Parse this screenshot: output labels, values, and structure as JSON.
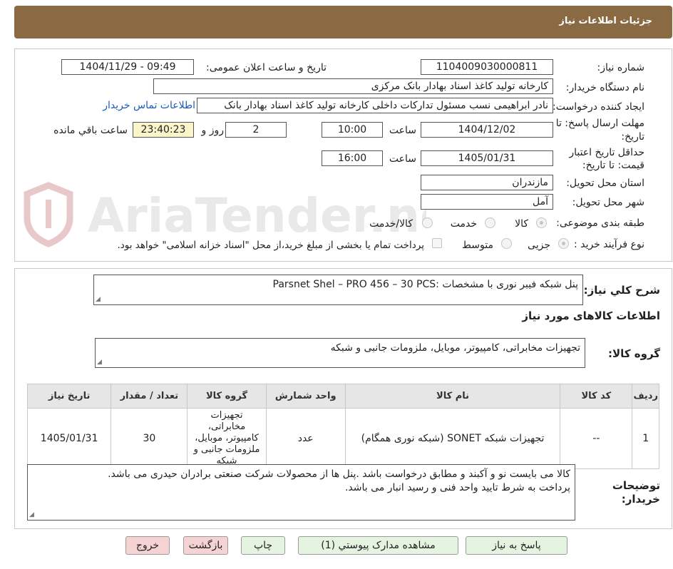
{
  "header": {
    "title": "جزئیات اطلاعات نیاز"
  },
  "form": {
    "need_number_label": "شماره نیاز:",
    "need_number": "1104009030000811",
    "announce_label": "تاریخ و ساعت اعلان عمومی:",
    "announce_value": "1404/11/29 - 09:49",
    "buyer_org_label": "نام دستگاه خریدار:",
    "buyer_org": "کارخانه تولید کاغذ اسناد بهادار بانک مرکزی",
    "creator_label": "ایجاد کننده درخواست:",
    "creator": "نادر ابراهیمی نسب مسئول تدارکات داخلی کارخانه تولید کاغذ اسناد بهادار بانک",
    "contact_link": "اطلاعات تماس خریدار",
    "deadline_label_1": "مهلت ارسال پاسخ: تا",
    "deadline_label_2": "تاریخ:",
    "deadline_date": "1404/12/02",
    "time_label": "ساعت",
    "deadline_time": "10:00",
    "days": "2",
    "days_label": "روز و",
    "remaining_time": "23:40:23",
    "remaining_label": "ساعت باقي مانده",
    "validity_label_1": "حداقل تاریخ اعتبار",
    "validity_label_2": "قیمت: تا تاریخ:",
    "validity_date": "1405/01/31",
    "validity_time": "16:00",
    "province_label": "استان محل تحویل:",
    "province": "مازندران",
    "city_label": "شهر محل تحویل:",
    "city": "آمل",
    "category_label": "طبقه بندی موضوعی:",
    "category_options": [
      "کالا",
      "خدمت",
      "کالا/خدمت"
    ],
    "process_label": "نوع فرآیند خرید :",
    "process_options": [
      "جزیی",
      "متوسط"
    ],
    "payment_note": "پرداخت تمام یا بخشی از مبلغ خرید،از محل \"اسناد خزانه اسلامی\" خواهد بود."
  },
  "details": {
    "description_label": "شرح کلي نیاز:",
    "description": "پنل شبکه فیبر نوری با مشخصات :Parsnet Shel – PRO 456 – 30 PCS",
    "goods_info_title": "اطلاعات کالاهای مورد نیاز",
    "goods_group_label": "گروه کالا:",
    "goods_group": "تجهیزات مخابراتی، کامپیوتر، موبایل، ملزومات جانبی و شبکه",
    "table": {
      "headers": [
        "ردیف",
        "کد کالا",
        "نام کالا",
        "واحد شمارش",
        "گروه کالا",
        "تعداد / مقدار",
        "تاریخ نیاز"
      ],
      "rows": [
        [
          "1",
          "--",
          "تجهیزات شبکه SONET (شبکه نوری همگام)",
          "عدد",
          "تجهیزات مخابراتی، کامپیوتر، موبایل، ملزومات جانبی و شبکه",
          "30",
          "1405/01/31"
        ]
      ]
    },
    "buyer_notes_label_1": "توضیحات",
    "buyer_notes_label_2": "خریدار:",
    "buyer_notes_line1": "کالا می بایست نو و آکبند و مطابق درخواست باشد .پنل ها از محصولات شرکت صنعتی برادران حیدری می باشد.",
    "buyer_notes_line2": "پرداخت به شرط تایید واحد فنی و رسید انبار می باشد."
  },
  "buttons": {
    "reply": "پاسخ به نیاز",
    "attachments": "مشاهده مدارک پیوستي (1)",
    "print": "چاپ",
    "back": "بازگشت",
    "exit": "خروج"
  },
  "colors": {
    "header_bg": "#8a6a43",
    "accent_link": "#1a5bb8",
    "remaining_bg": "#fbf6c9",
    "button_green": "#e5f3e1",
    "button_pink": "#f6d3d3"
  }
}
